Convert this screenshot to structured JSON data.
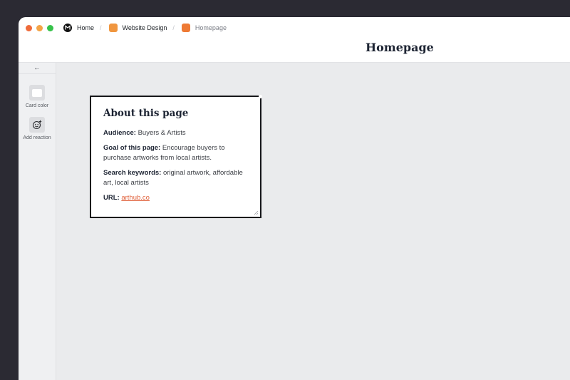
{
  "titlebar": {
    "traffic_colors": [
      "#ef6b3a",
      "#f4a446",
      "#36c24a"
    ],
    "breadcrumb": [
      {
        "label": "Home",
        "icon": "app-logo-icon"
      },
      {
        "label": "Website Design",
        "icon": "board-icon",
        "color": "#f0963f"
      },
      {
        "label": "Homepage",
        "icon": "board-icon",
        "color": "#ee7a35"
      }
    ]
  },
  "header": {
    "title": "Homepage"
  },
  "sidebar": {
    "back_icon": "arrow-left-icon",
    "tools": [
      {
        "label": "Card color",
        "icon": "card-color-icon"
      },
      {
        "label": "Add reaction",
        "icon": "add-reaction-icon"
      }
    ]
  },
  "card": {
    "title": "About this page",
    "fields": [
      {
        "label": "Audience:",
        "value": "Buyers & Artists"
      },
      {
        "label": "Goal of this page:",
        "value": "Encourage buyers to purchase artworks from local artists."
      },
      {
        "label": "Search keywords:",
        "value": "original artwork, affordable art, local artists"
      }
    ],
    "url": {
      "label": "URL:",
      "value": "arthub.co"
    },
    "accent_color": "#e0603a"
  }
}
